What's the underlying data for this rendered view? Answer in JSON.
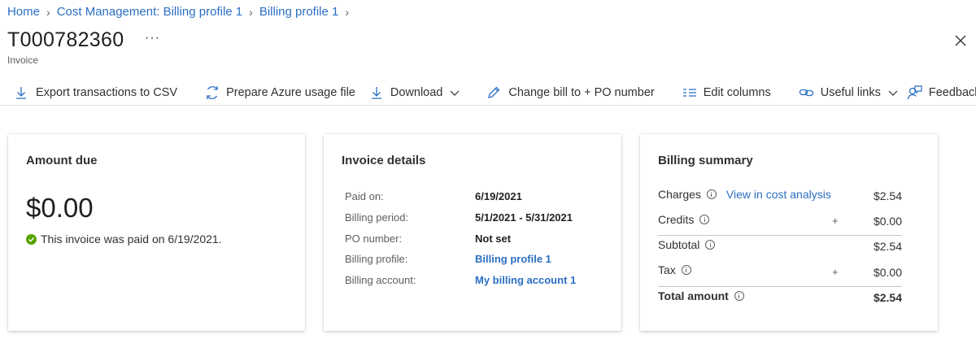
{
  "breadcrumb": {
    "home": "Home",
    "cost_management": "Cost Management: Billing profile 1",
    "billing_profile": "Billing profile 1"
  },
  "header": {
    "title": "T000782360",
    "more": "···",
    "subtitle": "Invoice"
  },
  "toolbar": {
    "export": "Export transactions to CSV",
    "prepare": "Prepare Azure usage file",
    "download": "Download",
    "change_bill": "Change bill to + PO number",
    "edit_columns": "Edit columns",
    "useful_links": "Useful links",
    "feedback": "Feedback"
  },
  "amount_due": {
    "title": "Amount due",
    "amount": "$0.00",
    "status": "This invoice was paid on 6/19/2021."
  },
  "invoice_details": {
    "title": "Invoice details",
    "rows": [
      {
        "label": "Paid on:",
        "value": "6/19/2021"
      },
      {
        "label": "Billing period:",
        "value": "5/1/2021 - 5/31/2021"
      },
      {
        "label": "PO number:",
        "value": "Not set"
      },
      {
        "label": "Billing profile:",
        "value": "Billing profile 1"
      },
      {
        "label": "Billing account:",
        "value": "My billing account 1"
      }
    ]
  },
  "billing_summary": {
    "title": "Billing summary",
    "charges_label": "Charges",
    "charges_link": "View in cost analysis",
    "charges_value": "$2.54",
    "credits_label": "Credits",
    "credits_sign": "+",
    "credits_value": "$0.00",
    "subtotal_label": "Subtotal",
    "subtotal_value": "$2.54",
    "tax_label": "Tax",
    "tax_sign": "+",
    "tax_value": "$0.00",
    "total_label": "Total amount",
    "total_value": "$2.54"
  },
  "colors": {
    "link": "#2b6fc2",
    "paid_check": "#57a300"
  }
}
